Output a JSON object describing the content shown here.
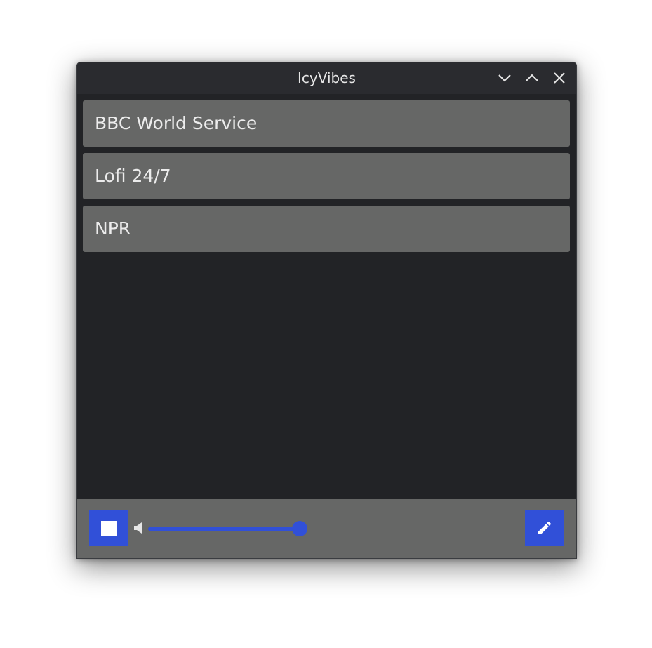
{
  "window": {
    "title": "IcyVibes"
  },
  "titlebar_buttons": [
    {
      "name": "minimize",
      "icon": "chevron-down-icon"
    },
    {
      "name": "maximize",
      "icon": "chevron-up-icon"
    },
    {
      "name": "close",
      "icon": "close-icon"
    }
  ],
  "stations": [
    {
      "label": "BBC World Service"
    },
    {
      "label": "Lofi 24/7"
    },
    {
      "label": "NPR"
    }
  ],
  "player": {
    "stop_icon": "stop-icon",
    "volume_icon": "volume-icon",
    "volume_level": 1.0,
    "edit_icon": "pencil-icon"
  },
  "colors": {
    "accent": "#3150d8",
    "window_bg": "#222326",
    "titlebar_bg": "#2a2b2f",
    "item_bg": "#666766",
    "text": "#ececec"
  }
}
